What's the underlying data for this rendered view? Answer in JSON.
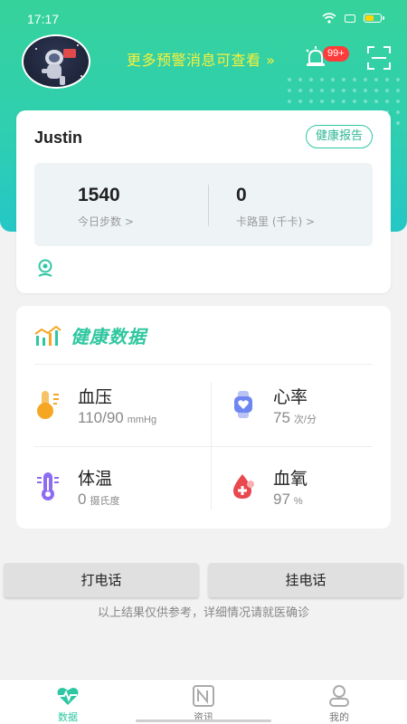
{
  "status_bar": {
    "time": "17:17"
  },
  "header": {
    "more_message": "更多预警消息可查看 »",
    "badge": "99+"
  },
  "user_card": {
    "name": "Justin",
    "report_button": "健康报告",
    "steps": {
      "value": "1540",
      "label": "今日步数 >"
    },
    "calories": {
      "value": "0",
      "label": "卡路里 (千卡) >"
    }
  },
  "health": {
    "title": "健康数据",
    "metrics": [
      {
        "name": "血压",
        "value": "110/90",
        "unit": "mmHg",
        "icon": "blood-pressure-icon"
      },
      {
        "name": "心率",
        "value": "75",
        "unit": "次/分",
        "icon": "watch-heart-icon"
      },
      {
        "name": "体温",
        "value": "0",
        "unit": "摄氏度",
        "icon": "thermometer-icon"
      },
      {
        "name": "血氧",
        "value": "97",
        "unit": "%",
        "icon": "blood-drop-icon"
      }
    ]
  },
  "actions": {
    "call": "打电话",
    "hangup": "挂电话"
  },
  "disclaimer": "以上结果仅供参考，详细情况请就医确诊",
  "tabs": [
    {
      "label": "数据",
      "icon": "heart-pulse-icon",
      "active": true
    },
    {
      "label": "资讯",
      "icon": "news-icon",
      "active": false
    },
    {
      "label": "我的",
      "icon": "profile-icon",
      "active": false
    }
  ],
  "colors": {
    "accent": "#2fc7a3",
    "warning_text": "#f7f03c",
    "badge": "#ff3b3b"
  }
}
